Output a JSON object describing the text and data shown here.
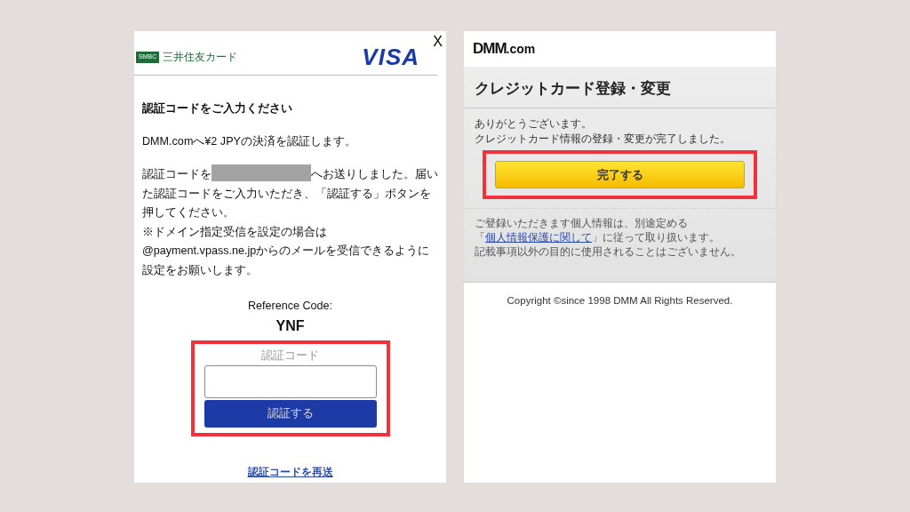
{
  "left_screen": {
    "brand": {
      "badge": "SMBC",
      "name": "三井住友カード"
    },
    "card_logo": "VISA",
    "close": "X",
    "heading": "認証コードをご入力ください",
    "payment_text": "DMM.comへ¥2 JPYの決済を認証します。",
    "sent_text_start": "認証コードを",
    "sent_text_end": "へお送りしました。届いた認証コードをご入力いただき、「認証する」ボタンを押してください。",
    "note_lines": [
      "※ドメイン指定受信を設定の場合は",
      "@payment.vpass.ne.jpからのメールを受信できるように設定をお願いします。"
    ],
    "reference_label": "Reference Code:",
    "reference_code": "YNF",
    "code_field": {
      "label": "認証コード"
    },
    "submit_button": "認証する",
    "resend_link": "認証コードを再送"
  },
  "right_screen": {
    "logo": {
      "main": "DMM",
      "suffix": ".com"
    },
    "title": "クレジットカード登録・変更",
    "message_lines": [
      "ありがとうございます。",
      "クレジットカード情報の登録・変更が完了しました。"
    ],
    "done_button": "完了する",
    "privacy_start": "ご登録いただきます個人情報は、別途定める「",
    "privacy_link": "個人情報保護に関して",
    "privacy_end": "」に従って取り扱います。",
    "notice": "記載事項以外の目的に使用されることはございません。",
    "copyright": "Copyright ©since 1998 DMM All Rights Reserved."
  }
}
